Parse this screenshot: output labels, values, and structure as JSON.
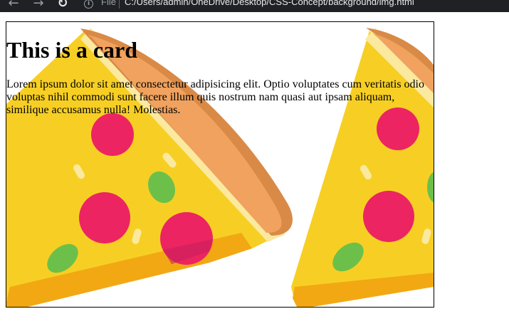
{
  "browser": {
    "back_icon": "←",
    "forward_icon": "→",
    "reload_icon": "↻",
    "scheme_label": "File",
    "url": "C:/Users/admin/OneDrive/Desktop/CSS-Concept/background/img.html"
  },
  "card": {
    "title": "This is a card",
    "body": "Lorem ipsum dolor sit amet consectetur adipisicing elit. Optio voluptates cum veritatis odio voluptas nihil commodi sunt facere illum quis nostrum nam quasi aut ipsam aliquam, similique accusamus nulla! Molestias.",
    "background_image": "pizza-slice-illustration"
  },
  "colors": {
    "toolbar": "#202124",
    "crust_dark": "#d98a46",
    "crust_light": "#f0a25e",
    "cheese": "#f7cf24",
    "cheese_highlight": "#fbe9a0",
    "pepperoni": "#ec2462",
    "basil": "#6cc04a",
    "shadow": "#f2a813"
  }
}
